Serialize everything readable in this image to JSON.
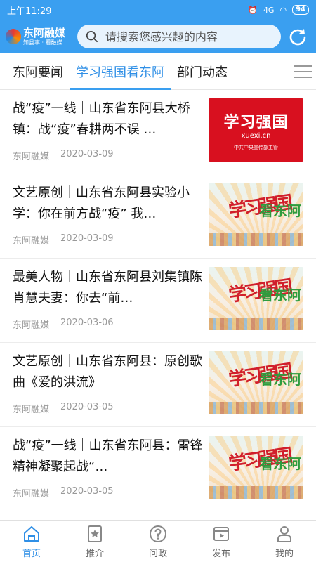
{
  "status": {
    "time": "上午11:29",
    "network": "4G",
    "battery": "94"
  },
  "header": {
    "logo_name": "东阿融媒",
    "logo_slogan": "知县事 · 看融媒",
    "search_placeholder": "请搜索您感兴趣的内容"
  },
  "tabs": [
    {
      "label": "东阿要闻",
      "active": false
    },
    {
      "label": "学习强国看东阿",
      "active": true
    },
    {
      "label": "部门动态",
      "active": false
    }
  ],
  "articles": [
    {
      "title": "战“疫”一线｜山东省东阿县大桥镇：战“疫”春耕两不误 …",
      "source": "东阿融媒",
      "date": "2020-03-09",
      "thumb": "xuexi-logo",
      "thumb_big": "学习强国",
      "thumb_url": "xuexi.cn",
      "thumb_sub": "中共中央宣传部主管"
    },
    {
      "title": "文艺原创｜山东省东阿县实验小学：你在前方战“疫” 我…",
      "source": "东阿融媒",
      "date": "2020-03-09",
      "thumb": "xuexi-dong-e",
      "thumb_a": "学习强国",
      "thumb_b": "看东阿"
    },
    {
      "title": "最美人物｜山东省东阿县刘集镇陈肖慧夫妻：你去“前…",
      "source": "东阿融媒",
      "date": "2020-03-06",
      "thumb": "xuexi-dong-e",
      "thumb_a": "学习强国",
      "thumb_b": "看东阿"
    },
    {
      "title": "文艺原创｜山东省东阿县：原创歌曲《爱的洪流》",
      "source": "东阿融媒",
      "date": "2020-03-05",
      "thumb": "xuexi-dong-e",
      "thumb_a": "学习强国",
      "thumb_b": "看东阿"
    },
    {
      "title": "战“疫”一线｜山东省东阿县：雷锋精神凝聚起战“…",
      "source": "东阿融媒",
      "date": "2020-03-05",
      "thumb": "xuexi-dong-e",
      "thumb_a": "学习强国",
      "thumb_b": "看东阿"
    }
  ],
  "tabbar": [
    {
      "label": "首页",
      "icon": "home-icon",
      "active": true
    },
    {
      "label": "推介",
      "icon": "star-book-icon",
      "active": false
    },
    {
      "label": "问政",
      "icon": "question-icon",
      "active": false
    },
    {
      "label": "发布",
      "icon": "video-icon",
      "active": false
    },
    {
      "label": "我的",
      "icon": "user-icon",
      "active": false
    }
  ],
  "colors": {
    "brand": "#3a9ff0",
    "active": "#2f8fe6",
    "xuexi_red": "#d8101f"
  }
}
